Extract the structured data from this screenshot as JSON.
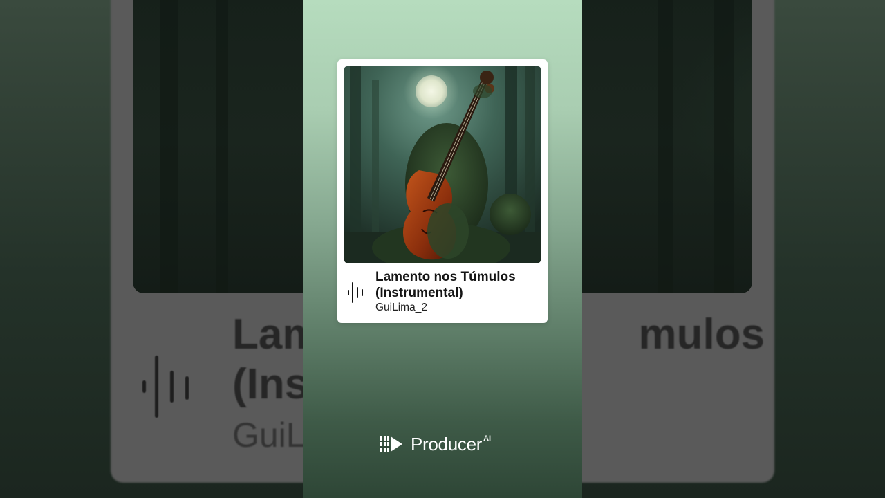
{
  "track": {
    "title": "Lamento nos Túmulos (Instrumental)",
    "artist": "GuiLima_2"
  },
  "background": {
    "title_fragment_1": "Lam",
    "title_fragment_2": "mulos",
    "title_fragment_3": "(Ins",
    "artist_fragment": "GuiL"
  },
  "brand": {
    "name": "Producer",
    "suffix": "AI"
  },
  "icons": {
    "waveform": "audio-waveform-icon",
    "logo": "producer-logo-icon"
  },
  "colors": {
    "card": "#ffffff",
    "panel_top": "#b6dcbe",
    "panel_bottom": "#2e4636",
    "brand_text": "#ffffff"
  }
}
